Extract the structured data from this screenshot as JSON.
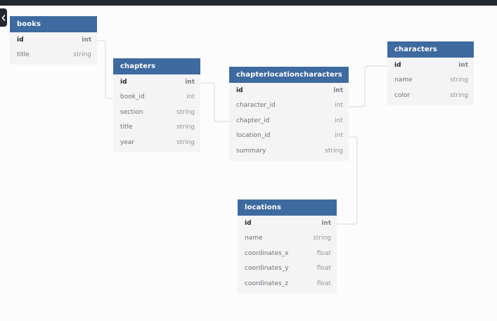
{
  "tables": {
    "books": {
      "name": "books",
      "columns": [
        {
          "name": "id",
          "type": "int"
        },
        {
          "name": "title",
          "type": "string"
        }
      ]
    },
    "chapters": {
      "name": "chapters",
      "columns": [
        {
          "name": "id",
          "type": "int"
        },
        {
          "name": "book_id",
          "type": "int"
        },
        {
          "name": "section",
          "type": "string"
        },
        {
          "name": "title",
          "type": "string"
        },
        {
          "name": "year",
          "type": "string"
        }
      ]
    },
    "chapterlocationcharacters": {
      "name": "chapterlocationcharacters",
      "columns": [
        {
          "name": "id",
          "type": "int"
        },
        {
          "name": "character_id",
          "type": "int"
        },
        {
          "name": "chapter_id",
          "type": "int"
        },
        {
          "name": "location_id",
          "type": "int"
        },
        {
          "name": "summary",
          "type": "string"
        }
      ]
    },
    "characters": {
      "name": "characters",
      "columns": [
        {
          "name": "id",
          "type": "int"
        },
        {
          "name": "name",
          "type": "string"
        },
        {
          "name": "color",
          "type": "string"
        }
      ]
    },
    "locations": {
      "name": "locations",
      "columns": [
        {
          "name": "id",
          "type": "int"
        },
        {
          "name": "name",
          "type": "string"
        },
        {
          "name": "coordinates_x",
          "type": "float"
        },
        {
          "name": "coordinates_y",
          "type": "float"
        },
        {
          "name": "coordinates_z",
          "type": "float"
        }
      ]
    }
  },
  "relations": [
    {
      "from": "books.id",
      "to": "chapters.book_id"
    },
    {
      "from": "chapters.id",
      "to": "chapterlocationcharacters.chapter_id"
    },
    {
      "from": "characters.id",
      "to": "chapterlocationcharacters.character_id"
    },
    {
      "from": "locations.id",
      "to": "chapterlocationcharacters.location_id"
    }
  ],
  "colors": {
    "header": "#3e6b9f",
    "topbar": "#23272e",
    "body": "#f4f4f5",
    "connector": "#d3d7dc"
  },
  "icons": {
    "sidebar_toggle": "chevron-left-icon"
  }
}
